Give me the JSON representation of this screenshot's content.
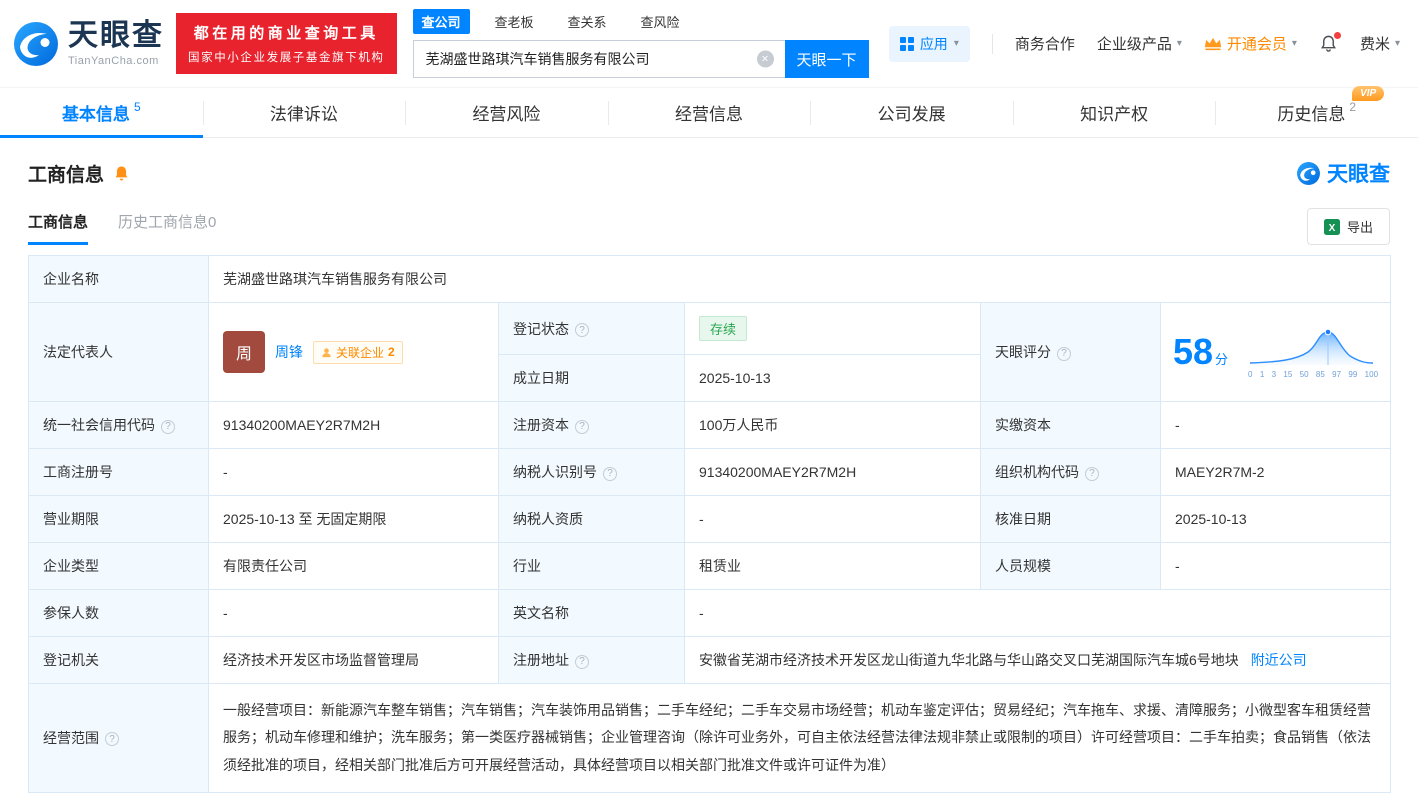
{
  "brand": {
    "name": "天眼查",
    "domain": "TianYanCha.com",
    "slogan_line1": "都在用的商业查询工具",
    "slogan_line2": "国家中小企业发展子基金旗下机构",
    "colors": {
      "primary": "#0084ff",
      "banner_red": "#e8232e",
      "vip_orange": "#ff8a00",
      "status_green": "#2aa64f"
    }
  },
  "search": {
    "tabs": [
      {
        "label": "查公司"
      },
      {
        "label": "查老板"
      },
      {
        "label": "查关系"
      },
      {
        "label": "查风险"
      }
    ],
    "value": "芜湖盛世路琪汽车销售服务有限公司",
    "button": "天眼一下"
  },
  "topnav": {
    "app": "应用",
    "cooperation": "商务合作",
    "enterprise": "企业级产品",
    "vip": "开通会员",
    "user": "费米"
  },
  "nav_tabs": [
    {
      "label": "基本信息",
      "count": "5"
    },
    {
      "label": "法律诉讼"
    },
    {
      "label": "经营风险"
    },
    {
      "label": "经营信息"
    },
    {
      "label": "公司发展"
    },
    {
      "label": "知识产权"
    },
    {
      "label": "历史信息",
      "count": "2",
      "vip": "VIP"
    }
  ],
  "section": {
    "title": "工商信息",
    "subtab_active": "工商信息",
    "subtab_history": "历史工商信息0",
    "export": "导出"
  },
  "biz": {
    "company_name_label": "企业名称",
    "company_name": "芜湖盛世路琪汽车销售服务有限公司",
    "legal_rep_label": "法定代表人",
    "legal_rep_avatar": "周",
    "legal_rep_name": "周锋",
    "related_badge": "关联企业",
    "related_count": "2",
    "status_label": "登记状态",
    "status_value": "存续",
    "founded_label": "成立日期",
    "founded_value": "2025-10-13",
    "score_label": "天眼评分",
    "score_value": "58",
    "score_unit": "分",
    "score_axis": [
      "0",
      "1",
      "3",
      "15",
      "50",
      "85",
      "97",
      "99",
      "100"
    ],
    "credit_code_label": "统一社会信用代码",
    "credit_code": "91340200MAEY2R7M2H",
    "reg_capital_label": "注册资本",
    "reg_capital": "100万人民币",
    "paid_capital_label": "实缴资本",
    "paid_capital": "-",
    "reg_no_label": "工商注册号",
    "reg_no": "-",
    "taxpayer_no_label": "纳税人识别号",
    "taxpayer_no": "91340200MAEY2R7M2H",
    "org_code_label": "组织机构代码",
    "org_code": "MAEY2R7M-2",
    "term_label": "营业期限",
    "term": "2025-10-13 至 无固定期限",
    "taxpayer_quality_label": "纳税人资质",
    "taxpayer_quality": "-",
    "approved_label": "核准日期",
    "approved": "2025-10-13",
    "type_label": "企业类型",
    "type": "有限责任公司",
    "industry_label": "行业",
    "industry": "租赁业",
    "staff_label": "人员规模",
    "staff": "-",
    "insured_label": "参保人数",
    "insured": "-",
    "en_name_label": "英文名称",
    "en_name": "-",
    "registry_label": "登记机关",
    "registry": "经济技术开发区市场监督管理局",
    "address_label": "注册地址",
    "address": "安徽省芜湖市经济技术开发区龙山街道九华北路与华山路交叉口芜湖国际汽车城6号地块",
    "nearby_link": "附近公司",
    "scope_label": "经营范围",
    "scope": "一般经营项目：新能源汽车整车销售；汽车销售；汽车装饰用品销售；二手车经纪；二手车交易市场经营；机动车鉴定评估；贸易经纪；汽车拖车、求援、清障服务；小微型客车租赁经营服务；机动车修理和维护；洗车服务；第一类医疗器械销售；企业管理咨询（除许可业务外，可自主依法经营法律法规非禁止或限制的项目）许可经营项目：二手车拍卖；食品销售（依法须经批准的项目，经相关部门批准后方可开展经营活动，具体经营项目以相关部门批准文件或许可证件为准）"
  },
  "glyphs": {
    "caret": "▾",
    "clear": "×",
    "help": "?",
    "excel": "X"
  }
}
